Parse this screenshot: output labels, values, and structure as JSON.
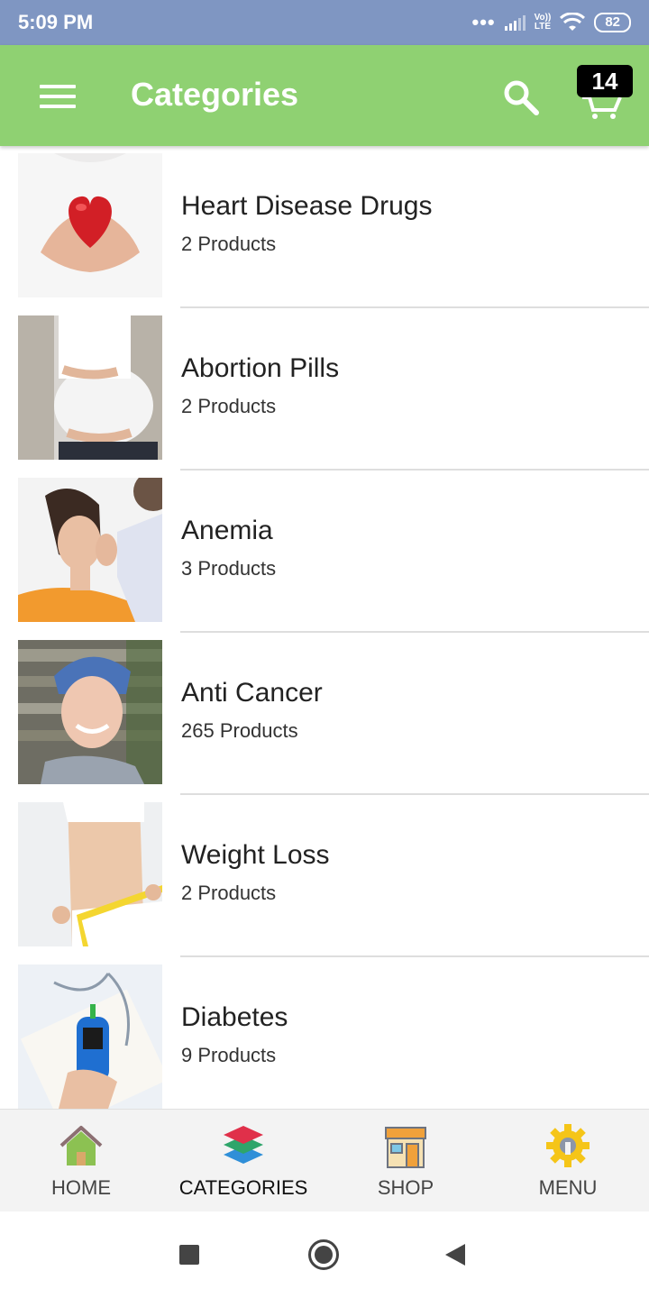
{
  "status_bar": {
    "time": "5:09 PM",
    "network": "LTE",
    "network_top": "Vo))",
    "battery": "82"
  },
  "app_bar": {
    "title": "Categories",
    "cart_count": "14",
    "color": "#8fd172"
  },
  "categories": [
    {
      "name": "Heart Disease Drugs",
      "count": "2 Products",
      "image": "heart-hands-image"
    },
    {
      "name": "Abortion Pills",
      "count": "2 Products",
      "image": "pregnant-woman-image"
    },
    {
      "name": "Anemia",
      "count": "3 Products",
      "image": "doctor-patient-image"
    },
    {
      "name": "Anti Cancer",
      "count": "265 Products",
      "image": "smiling-woman-headscarf-image"
    },
    {
      "name": "Weight Loss",
      "count": "2 Products",
      "image": "measuring-tape-waist-image"
    },
    {
      "name": "Diabetes",
      "count": "9 Products",
      "image": "glucose-meter-image"
    }
  ],
  "bottom_nav": {
    "items": [
      {
        "label": "HOME",
        "icon": "home-icon",
        "active": false
      },
      {
        "label": "CATEGORIES",
        "icon": "layers-icon",
        "active": true
      },
      {
        "label": "SHOP",
        "icon": "shop-icon",
        "active": false
      },
      {
        "label": "MENU",
        "icon": "gear-wrench-icon",
        "active": false
      }
    ]
  }
}
